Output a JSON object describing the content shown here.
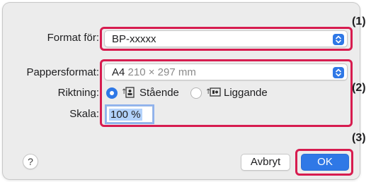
{
  "format_for": {
    "label": "Format för:",
    "value": "BP-xxxxx"
  },
  "paper": {
    "label": "Pappersformat:",
    "value": "A4",
    "size_text": "210 × 297 mm"
  },
  "orientation": {
    "label": "Riktning:",
    "options": [
      {
        "label": "Stående",
        "selected": true
      },
      {
        "label": "Liggande",
        "selected": false
      }
    ]
  },
  "scale": {
    "label": "Skala:",
    "value": "100 %"
  },
  "buttons": {
    "help": "?",
    "cancel": "Avbryt",
    "ok": "OK"
  },
  "callouts": [
    "(1)",
    "(2)",
    "(3)"
  ],
  "colors": {
    "accent": "#2f78e6",
    "highlight": "#d71c4f",
    "dialog_bg": "#ececec"
  }
}
